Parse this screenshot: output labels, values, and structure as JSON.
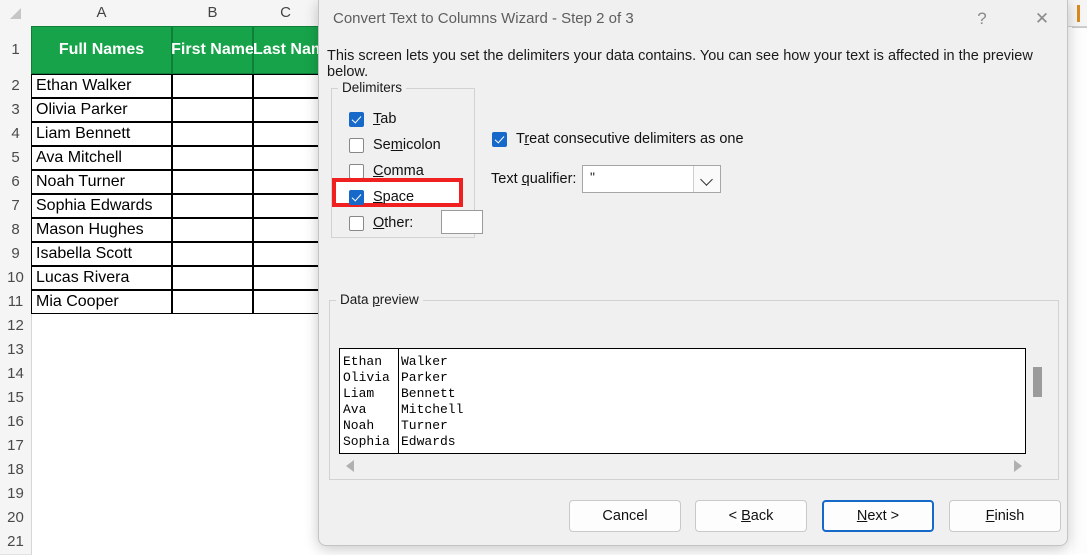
{
  "spreadsheet": {
    "column_headers": [
      "A",
      "B",
      "C"
    ],
    "row_numbers": [
      "1",
      "2",
      "3",
      "4",
      "5",
      "6",
      "7",
      "8",
      "9",
      "10",
      "11",
      "12",
      "13",
      "14",
      "15",
      "16",
      "17",
      "18",
      "19",
      "20",
      "21"
    ],
    "header_fill_color": "#17a34a",
    "table_headers": [
      "Full Names",
      "First Name",
      "Last Name"
    ],
    "rows": [
      {
        "full_name": "Ethan Walker"
      },
      {
        "full_name": "Olivia Parker"
      },
      {
        "full_name": "Liam Bennett"
      },
      {
        "full_name": "Ava Mitchell"
      },
      {
        "full_name": "Noah Turner"
      },
      {
        "full_name": "Sophia Edwards"
      },
      {
        "full_name": "Mason Hughes"
      },
      {
        "full_name": "Isabella Scott"
      },
      {
        "full_name": "Lucas Rivera"
      },
      {
        "full_name": "Mia Cooper"
      }
    ]
  },
  "dialog": {
    "title": "Convert Text to Columns Wizard - Step 2 of 3",
    "help_glyph": "?",
    "close_glyph": "✕",
    "subtitle": "This screen lets you set the delimiters your data contains.  You can see how your text is affected in the preview below.",
    "delimiters": {
      "group_label": "Delimiters",
      "items": [
        {
          "label": "Tab",
          "accel": "T",
          "checked": true
        },
        {
          "label": "Semicolon",
          "accel": "m",
          "checked": false
        },
        {
          "label": "Comma",
          "accel": "C",
          "checked": false
        },
        {
          "label": "Space",
          "accel": "S",
          "checked": true,
          "highlighted": true
        },
        {
          "label": "Other:",
          "accel": "O",
          "checked": false,
          "has_input": true,
          "input_value": ""
        }
      ],
      "highlight_color": "#f02020"
    },
    "treat_consecutive": {
      "label": "Treat consecutive delimiters as one",
      "accel": "r",
      "checked": true
    },
    "text_qualifier": {
      "label": "Text qualifier:",
      "accel": "q",
      "value": "\""
    },
    "data_preview": {
      "group_label": "Data preview",
      "accel": "p",
      "columns": [
        [
          "Ethan",
          "Olivia",
          "Liam",
          "Ava",
          "Noah",
          "Sophia"
        ],
        [
          "Walker",
          "Parker",
          "Bennett",
          "Mitchell",
          "Turner",
          "Edwards"
        ]
      ]
    },
    "buttons": [
      {
        "label": "Cancel",
        "accel": "",
        "focused": false
      },
      {
        "label": "< Back",
        "accel": "B",
        "focused": false
      },
      {
        "label": "Next >",
        "accel": "N",
        "focused": true
      },
      {
        "label": "Finish",
        "accel": "F",
        "focused": false
      }
    ]
  }
}
